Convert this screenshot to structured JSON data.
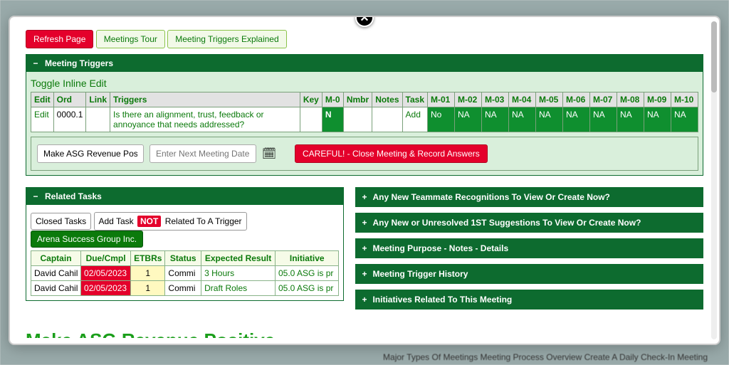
{
  "modal": {
    "close_label": "✕"
  },
  "top_buttons": {
    "refresh": "Refresh Page",
    "meetings_tour": "Meetings Tour",
    "triggers_explained": "Meeting Triggers Explained"
  },
  "triggers_panel": {
    "title": "Meeting Triggers",
    "toggle_label": "Toggle Inline Edit",
    "headers": {
      "edit": "Edit",
      "ord": "Ord",
      "link": "Link",
      "triggers": "Triggers",
      "key": "Key",
      "m0": "M-0",
      "nmbr": "Nmbr",
      "notes": "Notes",
      "task": "Task",
      "m01": "M-01",
      "m02": "M-02",
      "m03": "M-03",
      "m04": "M-04",
      "m05": "M-05",
      "m06": "M-06",
      "m07": "M-07",
      "m08": "M-08",
      "m09": "M-09",
      "m10": "M-10"
    },
    "row": {
      "edit": "Edit",
      "ord": "0000.1",
      "link": "",
      "trigger_q": "Is there an alignment, trust, feedback or annoyance that needs addressed?",
      "key": "",
      "m0": "N",
      "nmbr": "",
      "notes": "",
      "task": "Add",
      "m01": "No",
      "m02": "NA",
      "m03": "NA",
      "m04": "NA",
      "m05": "NA",
      "m06": "NA",
      "m07": "NA",
      "m08": "NA",
      "m09": "NA",
      "m10": "NA"
    },
    "actions": {
      "make_asg_value": "Make ASG Revenue Posi",
      "next_meeting_placeholder": "Enter Next Meeting Date",
      "close_meeting": "CAREFUL! - Close Meeting & Record Answers"
    }
  },
  "related_tasks": {
    "title": "Related Tasks",
    "buttons": {
      "closed_tasks": "Closed Tasks",
      "add_task_pre": "Add Task",
      "not_chip": "NOT",
      "add_task_post": "Related To A Trigger",
      "company": "Arena Success Group Inc."
    },
    "headers": {
      "captain": "Captain",
      "due": "Due/Cmpl",
      "etbrs": "ETBRs",
      "status": "Status",
      "expected": "Expected Result",
      "initiative": "Initiative"
    },
    "rows": [
      {
        "captain": "David Cahil",
        "due": "02/05/2023",
        "etbrs": "1",
        "status": "Commi",
        "expected": "3 Hours",
        "initiative": "05.0 ASG is pr"
      },
      {
        "captain": "David Cahil",
        "due": "02/05/2023",
        "etbrs": "1",
        "status": "Commi",
        "expected": "Draft Roles",
        "initiative": "05.0 ASG is pr"
      }
    ]
  },
  "right_panels": {
    "p1": "Any New Teammate Recognitions To View Or Create Now?",
    "p2": "Any New or Unresolved 1ST Suggestions To View Or Create Now?",
    "p3": "Meeting Purpose - Notes - Details",
    "p4": "Meeting Trigger History",
    "p5": "Initiatives Related To This Meeting"
  },
  "big_heading": "Make ASG Revenue Positive",
  "footer_hint": "Major Types Of Meetings Meeting Process Overview Create A Daily Check-In Meeting",
  "icons": {
    "minus": "−",
    "plus": "+",
    "calendar": "🗓"
  }
}
